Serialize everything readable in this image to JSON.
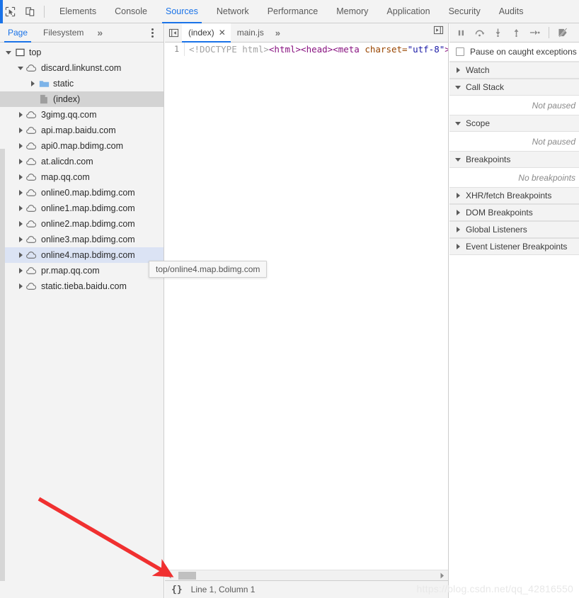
{
  "topbar": {
    "icons": [
      {
        "name": "inspect-element-icon",
        "title": "Inspect element"
      },
      {
        "name": "device-toolbar-icon",
        "title": "Toggle device toolbar"
      }
    ],
    "tabs": [
      {
        "label": "Elements",
        "active": false
      },
      {
        "label": "Console",
        "active": false
      },
      {
        "label": "Sources",
        "active": true
      },
      {
        "label": "Network",
        "active": false
      },
      {
        "label": "Performance",
        "active": false
      },
      {
        "label": "Memory",
        "active": false
      },
      {
        "label": "Application",
        "active": false
      },
      {
        "label": "Security",
        "active": false
      },
      {
        "label": "Audits",
        "active": false
      }
    ]
  },
  "navigator": {
    "tabs": [
      {
        "label": "Page",
        "active": true
      },
      {
        "label": "Filesystem",
        "active": false
      }
    ],
    "more_label": "»",
    "kebab_name": "more-options-icon",
    "tree": [
      {
        "label": "top",
        "indent": 0,
        "twisty": "open",
        "icon": "frame-icon",
        "state": "none"
      },
      {
        "label": "discard.linkunst.com",
        "indent": 1,
        "twisty": "open",
        "icon": "cloud-icon",
        "state": "none"
      },
      {
        "label": "static",
        "indent": 2,
        "twisty": "closed",
        "icon": "folder-icon",
        "state": "none"
      },
      {
        "label": "(index)",
        "indent": 2,
        "twisty": "none",
        "icon": "file-icon",
        "state": "selected"
      },
      {
        "label": "3gimg.qq.com",
        "indent": 1,
        "twisty": "closed",
        "icon": "cloud-icon",
        "state": "none"
      },
      {
        "label": "api.map.baidu.com",
        "indent": 1,
        "twisty": "closed",
        "icon": "cloud-icon",
        "state": "none"
      },
      {
        "label": "api0.map.bdimg.com",
        "indent": 1,
        "twisty": "closed",
        "icon": "cloud-icon",
        "state": "none"
      },
      {
        "label": "at.alicdn.com",
        "indent": 1,
        "twisty": "closed",
        "icon": "cloud-icon",
        "state": "none"
      },
      {
        "label": "map.qq.com",
        "indent": 1,
        "twisty": "closed",
        "icon": "cloud-icon",
        "state": "none"
      },
      {
        "label": "online0.map.bdimg.com",
        "indent": 1,
        "twisty": "closed",
        "icon": "cloud-icon",
        "state": "none"
      },
      {
        "label": "online1.map.bdimg.com",
        "indent": 1,
        "twisty": "closed",
        "icon": "cloud-icon",
        "state": "none"
      },
      {
        "label": "online2.map.bdimg.com",
        "indent": 1,
        "twisty": "closed",
        "icon": "cloud-icon",
        "state": "none"
      },
      {
        "label": "online3.map.bdimg.com",
        "indent": 1,
        "twisty": "closed",
        "icon": "cloud-icon",
        "state": "none"
      },
      {
        "label": "online4.map.bdimg.com",
        "indent": 1,
        "twisty": "closed",
        "icon": "cloud-icon",
        "state": "hovered"
      },
      {
        "label": "pr.map.qq.com",
        "indent": 1,
        "twisty": "closed",
        "icon": "cloud-icon",
        "state": "none"
      },
      {
        "label": "static.tieba.baidu.com",
        "indent": 1,
        "twisty": "closed",
        "icon": "cloud-icon",
        "state": "none"
      }
    ]
  },
  "tooltip": {
    "text": "top/online4.map.bdimg.com"
  },
  "editor": {
    "tabs": [
      {
        "label": "(index)",
        "active": true,
        "closable": true
      },
      {
        "label": "main.js",
        "active": false,
        "closable": false
      }
    ],
    "more_label": "»",
    "code": {
      "line_number": "1",
      "tokens": [
        {
          "text": "<!DOCTYPE html>",
          "type": "doctype"
        },
        {
          "text": "<html><head><meta ",
          "type": "tag"
        },
        {
          "text": "charset=",
          "type": "attr"
        },
        {
          "text": "\"utf-8\"",
          "type": "val"
        },
        {
          "text": "><",
          "type": "tag"
        }
      ]
    },
    "status": {
      "pretty_print_label": "{}",
      "cursor_label": "Line 1, Column 1"
    }
  },
  "debugger": {
    "toolbar": [
      {
        "name": "pause-resume-icon",
        "title": "Pause script execution"
      },
      {
        "name": "step-over-icon",
        "title": "Step over next function call"
      },
      {
        "name": "step-into-icon",
        "title": "Step into next function call"
      },
      {
        "name": "step-out-icon",
        "title": "Step out of current function"
      },
      {
        "name": "step-icon",
        "title": "Step"
      },
      {
        "name": "deactivate-breakpoints-icon",
        "title": "Deactivate breakpoints"
      }
    ],
    "pause_on_exceptions": {
      "label": "Pause on caught exceptions",
      "checked": false
    },
    "sections": [
      {
        "title": "Watch",
        "expanded": false,
        "empty_text": ""
      },
      {
        "title": "Call Stack",
        "expanded": true,
        "empty_text": "Not paused"
      },
      {
        "title": "Scope",
        "expanded": true,
        "empty_text": "Not paused"
      },
      {
        "title": "Breakpoints",
        "expanded": true,
        "empty_text": "No breakpoints"
      },
      {
        "title": "XHR/fetch Breakpoints",
        "expanded": false,
        "empty_text": ""
      },
      {
        "title": "DOM Breakpoints",
        "expanded": false,
        "empty_text": ""
      },
      {
        "title": "Global Listeners",
        "expanded": false,
        "empty_text": ""
      },
      {
        "title": "Event Listener Breakpoints",
        "expanded": false,
        "empty_text": ""
      }
    ]
  },
  "annotation": {
    "arrow_color": "#f03030",
    "name": "red-pointer-arrow"
  },
  "watermark": {
    "text": "https://blog.csdn.net/qq_42816550"
  },
  "colors": {
    "accent": "#1a73e8",
    "panel_bg": "#f3f3f3",
    "selected_row": "#d3d3d3",
    "hovered_row": "#dbe3f4"
  }
}
